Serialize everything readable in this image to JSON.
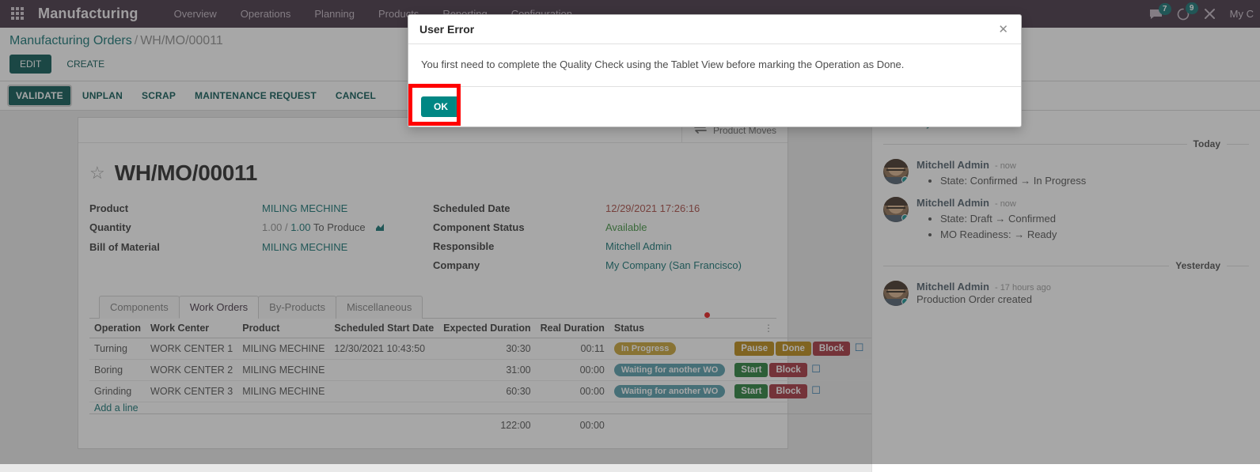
{
  "navbar": {
    "apps_icon": "apps-grid-icon",
    "brand": "Manufacturing",
    "menus": [
      "Overview",
      "Operations",
      "Planning",
      "Products",
      "Reporting",
      "Configuration"
    ],
    "messages_icon": "chat-bubble-icon",
    "messages_count": "7",
    "activities_icon": "clock-icon",
    "activities_count": "9",
    "debug_icon": "wrench-icon",
    "user_name": "My C"
  },
  "breadcrumb": {
    "root": "Manufacturing Orders",
    "separator": "/",
    "current": "WH/MO/00011"
  },
  "cp_buttons": {
    "edit": "EDIT",
    "create": "CREATE"
  },
  "statusbar": {
    "buttons": [
      "VALIDATE",
      "UNPLAN",
      "SCRAP",
      "MAINTENANCE REQUEST",
      "CANCEL"
    ],
    "active": "VALIDATE"
  },
  "stat_button": {
    "icon": "exchange-arrows-icon",
    "label": "Product Moves"
  },
  "record": {
    "star_icon": "star-outline-icon",
    "title": "WH/MO/00011",
    "left_fields": [
      {
        "label": "Product",
        "value": "MILING MECHINE",
        "style": "link"
      },
      {
        "label": "Quantity",
        "value": "",
        "style": "qty"
      },
      {
        "label": "Bill of Material",
        "value": "MILING MECHINE",
        "style": "link"
      }
    ],
    "quantity": {
      "done": "1.00",
      "sep": "/",
      "total": "1.00",
      "suffix": "To Produce",
      "chart_icon": "bar-chart-icon"
    },
    "right_fields": [
      {
        "label": "Scheduled Date",
        "value": "12/29/2021 17:26:16",
        "style": "danger"
      },
      {
        "label": "Component Status",
        "value": "Available",
        "style": "success"
      },
      {
        "label": "Responsible",
        "value": "Mitchell Admin",
        "style": "link"
      },
      {
        "label": "Company",
        "value": "My Company (San Francisco)",
        "style": "link"
      }
    ]
  },
  "notebook": {
    "tabs": [
      "Components",
      "Work Orders",
      "By-Products",
      "Miscellaneous"
    ],
    "active_tab": "Work Orders",
    "options_icon": "vertical-dots-icon"
  },
  "work_orders": {
    "columns": [
      "Operation",
      "Work Center",
      "Product",
      "Scheduled Start Date",
      "Expected Duration",
      "Real Duration",
      "Status",
      "",
      ""
    ],
    "rows": [
      {
        "operation": "Turning",
        "work_center": "WORK CENTER 1",
        "product": "MILING MECHINE",
        "start_date": "12/30/2021 10:43:50",
        "expected": "30:30",
        "real": "00:11",
        "status": "In Progress",
        "status_kind": "progress",
        "actions": [
          "Pause",
          "Done",
          "Block"
        ],
        "action_kinds": [
          "pause",
          "done",
          "block"
        ],
        "tablet_icon": "tablet-view-icon",
        "delete_icon": "trash-icon"
      },
      {
        "operation": "Boring",
        "work_center": "WORK CENTER 2",
        "product": "MILING MECHINE",
        "start_date": "",
        "expected": "31:00",
        "real": "00:00",
        "status": "Waiting for another WO",
        "status_kind": "waiting",
        "actions": [
          "Start",
          "Block"
        ],
        "action_kinds": [
          "start",
          "block"
        ],
        "tablet_icon": "tablet-view-icon",
        "delete_icon": "trash-icon"
      },
      {
        "operation": "Grinding",
        "work_center": "WORK CENTER 3",
        "product": "MILING MECHINE",
        "start_date": "",
        "expected": "60:30",
        "real": "00:00",
        "status": "Waiting for another WO",
        "status_kind": "waiting",
        "actions": [
          "Start",
          "Block"
        ],
        "action_kinds": [
          "start",
          "block"
        ],
        "tablet_icon": "tablet-view-icon",
        "delete_icon": "trash-icon"
      }
    ],
    "add_line": "Add a line",
    "totals": {
      "expected": "122:00",
      "real": "00:00"
    }
  },
  "chatter": {
    "schedule_activity": "ule activity",
    "groups": [
      {
        "day": "Today",
        "messages": [
          {
            "author": "Mitchell Admin",
            "time": "- now",
            "lines": [
              "State: Confirmed → In Progress"
            ],
            "text": ""
          },
          {
            "author": "Mitchell Admin",
            "time": "- now",
            "lines": [
              "State: Draft → Confirmed",
              "MO Readiness: → Ready"
            ],
            "text": ""
          }
        ]
      },
      {
        "day": "Yesterday",
        "messages": [
          {
            "author": "Mitchell Admin",
            "time": "- 17 hours ago",
            "lines": [],
            "text": "Production Order created"
          }
        ]
      }
    ]
  },
  "modal": {
    "title": "User Error",
    "close_icon": "close-icon",
    "message": "You first need to complete the Quality Check using the Tablet View before marking the Operation as Done.",
    "ok_label": "OK",
    "highlight_color": "#ff0000",
    "ok_color": "#008784"
  }
}
